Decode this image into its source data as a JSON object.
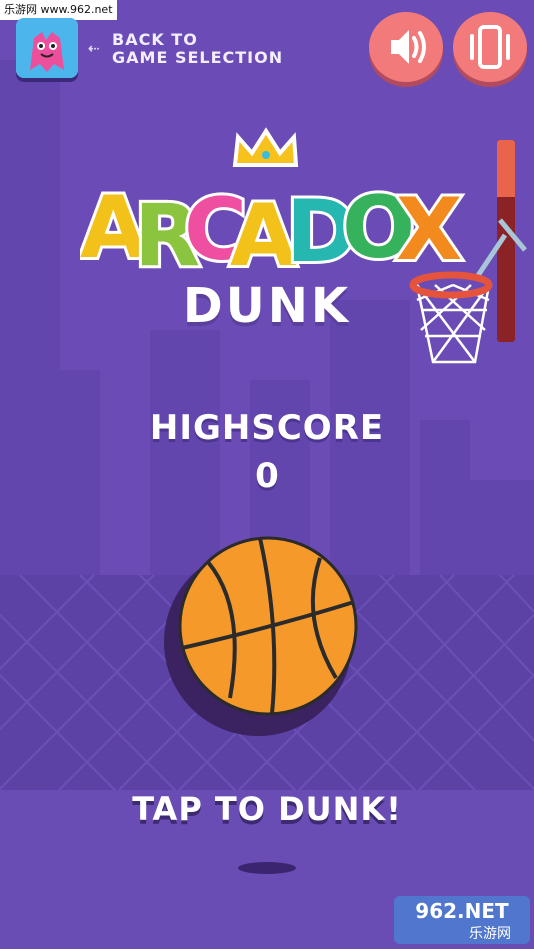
{
  "watermark_top": "乐游网 www.962.net",
  "back": {
    "line1": "BACK TO",
    "line2": "GAME SELECTION",
    "arrow": "⇠"
  },
  "buttons": {
    "sound_icon": "speaker-icon",
    "vibrate_icon": "vibrate-icon"
  },
  "logo": {
    "text": "ARCADOX",
    "letters": [
      "A",
      "R",
      "C",
      "A",
      "D",
      "O",
      "X"
    ],
    "colors": [
      "#f2c21b",
      "#8bc43f",
      "#ef4fa0",
      "#f2c21b",
      "#26b7b0",
      "#36b25c",
      "#f28a1e"
    ]
  },
  "subtitle": "DUNK",
  "highscore": {
    "label": "HIGHSCORE",
    "value": "0"
  },
  "power": {
    "level": 0.28
  },
  "cta": "TAP TO DUNK!",
  "watermark_bottom": {
    "line1": "962.NET",
    "line2": "乐游网"
  },
  "colors": {
    "background": "#6b4cb6",
    "ball": "#f59a2a",
    "button": "#f37a7a",
    "rim": "#e5533d"
  }
}
